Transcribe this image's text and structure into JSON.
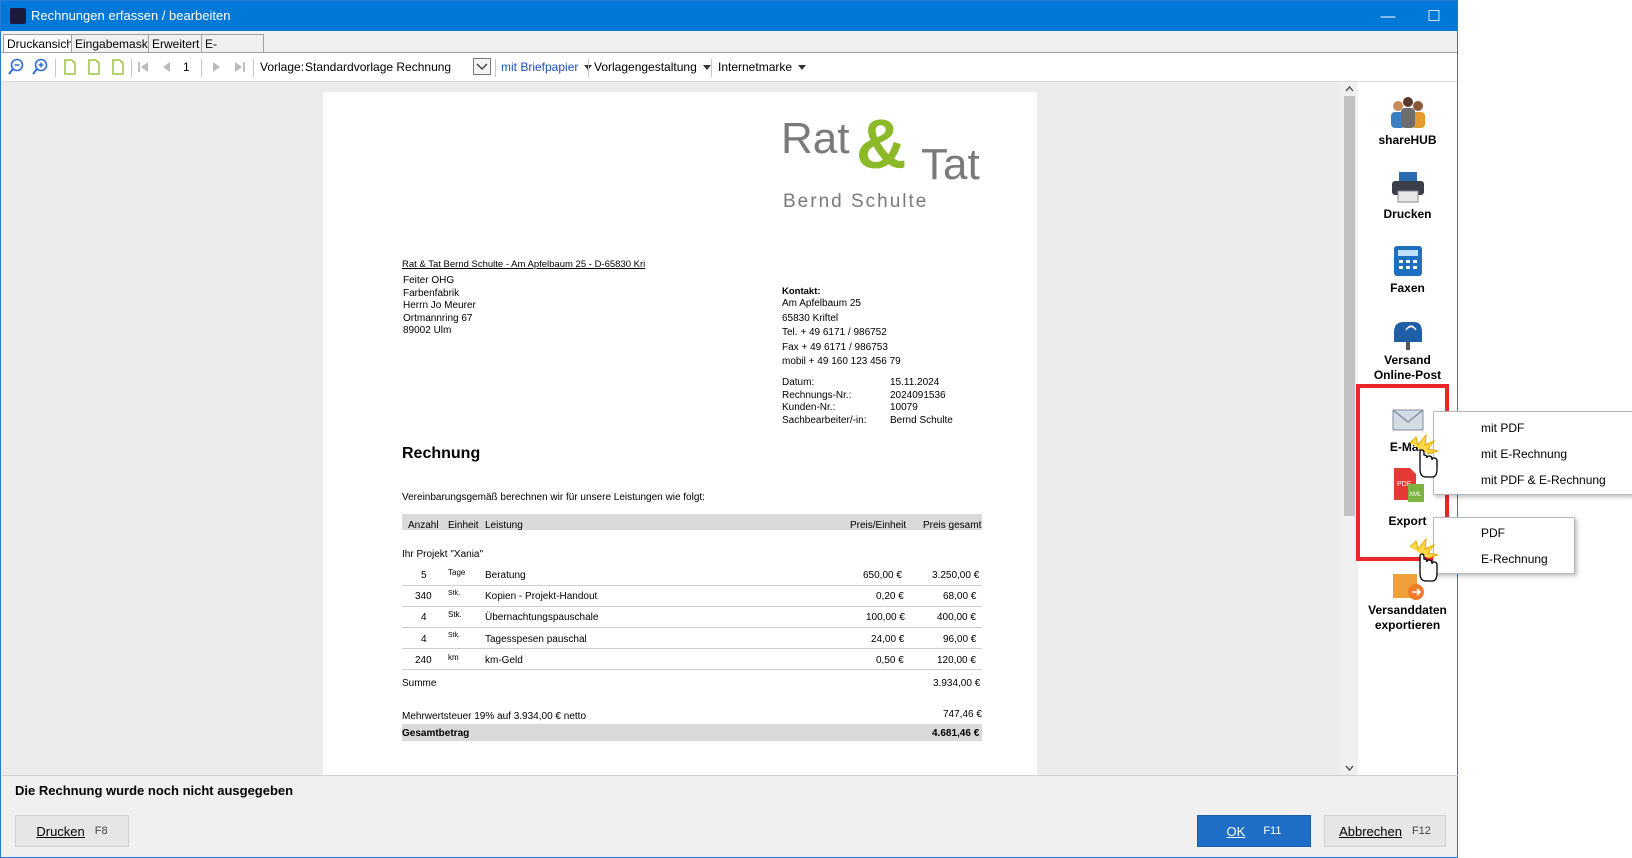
{
  "window": {
    "title": "Rechnungen erfassen / bearbeiten",
    "min_label": "—",
    "max_label": "☐",
    "close_label": "✕"
  },
  "tabs": [
    "Druckansicht",
    "Eingabemaske",
    "Erweitert",
    "E-Rechnung"
  ],
  "toolbar": {
    "page_number": "1",
    "template_label": "Vorlage:",
    "template_value": "Standardvorlage Rechnung",
    "letterhead": "mit Briefpapier",
    "template_design": "Vorlagengestaltung",
    "internet_stamp": "Internetmarke"
  },
  "document": {
    "logo_rat": "Rat",
    "logo_amp": "&",
    "logo_tat": "Tat",
    "logo_sub": "Bernd Schulte",
    "sender_line": "Rat & Tat Bernd Schulte - Am Apfelbaum 25 - D-65830 Kri",
    "recipient": [
      "Feiter OHG",
      "Farbenfabrik",
      "Herrn Jo Meurer",
      "Ortmannring 67",
      "89002 Ulm"
    ],
    "contact_heading": "Kontakt:",
    "contact": [
      "Am Apfelbaum 25",
      "65830 Kriftel",
      "Tel. + 49 6171 / 986752",
      "Fax + 49 6171 / 986753",
      "mobil + 49 160 123 456 79"
    ],
    "meta": [
      {
        "label": "Datum:",
        "value": "15.11.2024"
      },
      {
        "label": "Rechnungs-Nr.:",
        "value": "2024091536"
      },
      {
        "label": "Kunden-Nr.:",
        "value": "10079"
      },
      {
        "label": "Sachbearbeiter/-in:",
        "value": "Bernd Schulte"
      }
    ],
    "heading": "Rechnung",
    "intro": "Vereinbarungsgemäß berechnen wir für unsere Leistungen wie folgt:",
    "columns": {
      "qty": "Anzahl",
      "unit": "Einheit",
      "desc": "Leistung",
      "price": "Preis/Einheit",
      "total": "Preis gesamt"
    },
    "project": "Ihr Projekt \"Xania\"",
    "rows": [
      {
        "qty": "5",
        "unit": "Tage",
        "desc": "Beratung",
        "price": "650,00 €",
        "total": "3.250,00 €"
      },
      {
        "qty": "340",
        "unit": "Stk.",
        "desc": "Kopien - Projekt-Handout",
        "price": "0,20 €",
        "total": "68,00 €"
      },
      {
        "qty": "4",
        "unit": "Stk.",
        "desc": "Übernachtungspauschale",
        "price": "100,00 €",
        "total": "400,00 €"
      },
      {
        "qty": "4",
        "unit": "Stk.",
        "desc": "Tagesspesen pauschal",
        "price": "24,00 €",
        "total": "96,00 €"
      },
      {
        "qty": "240",
        "unit": "km",
        "desc": "km-Geld",
        "price": "0,50 €",
        "total": "120,00 €"
      }
    ],
    "sum_label": "Summe",
    "sum_value": "3.934,00 €",
    "vat_label": "Mehrwertsteuer 19% auf 3.934,00 € netto",
    "vat_value": "747,46 €",
    "total_label": "Gesamtbetrag",
    "total_value": "4.681,46 €"
  },
  "side_panel": {
    "sharehub": "shareHUB",
    "print": "Drucken",
    "fax": "Faxen",
    "online_post": [
      "Versand",
      "Online-Post"
    ],
    "email": "E-Mail",
    "export": "Export",
    "shipping_export": [
      "Versanddaten",
      "exportieren"
    ]
  },
  "email_menu": [
    "mit PDF",
    "mit E-Rechnung",
    "mit PDF & E-Rechnung"
  ],
  "export_menu": [
    "PDF",
    "E-Rechnung"
  ],
  "status": "Die Rechnung wurde noch nicht ausgegeben",
  "buttons": {
    "print": "Drucken",
    "print_key": "F8",
    "ok": "OK",
    "ok_key": "F11",
    "cancel": "Abbrechen",
    "cancel_key": "F12"
  },
  "colors": {
    "accent": "#0078d7",
    "highlight": "#e8262b",
    "logo_green": "#8db828",
    "logo_gray": "#7a7a7a",
    "ok_button": "#1e6ec8"
  },
  "icons": [
    "zoom-out-icon",
    "zoom-in-icon",
    "page-icon",
    "first-page-icon",
    "prev-page-icon",
    "next-page-icon",
    "last-page-icon",
    "sharehub-icon",
    "printer-icon",
    "fax-icon",
    "mailbox-icon",
    "envelope-icon",
    "pdf-xml-icon",
    "shipping-box-icon",
    "hand-cursor-icon"
  ]
}
